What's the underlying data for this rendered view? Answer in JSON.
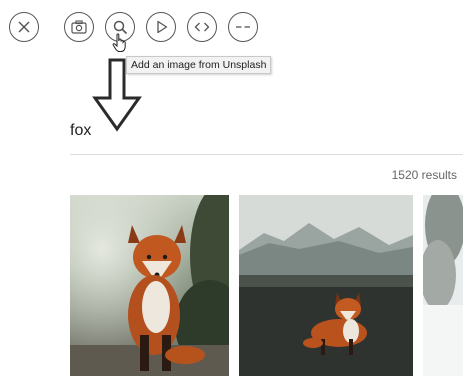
{
  "toolbar": {
    "buttons": [
      {
        "name": "close",
        "icon": "close-icon"
      },
      {
        "name": "camera",
        "icon": "camera-icon"
      },
      {
        "name": "search",
        "icon": "search-icon"
      },
      {
        "name": "play",
        "icon": "play-icon"
      },
      {
        "name": "embed",
        "icon": "code-icon"
      },
      {
        "name": "divider",
        "icon": "dashes-icon"
      }
    ],
    "tooltip": "Add an image from Unsplash"
  },
  "search": {
    "value": "fox",
    "results": "1520 results"
  },
  "colors": {
    "icon_stroke": "#555555",
    "divider": "#dcdcdc",
    "muted_text": "#666666"
  }
}
